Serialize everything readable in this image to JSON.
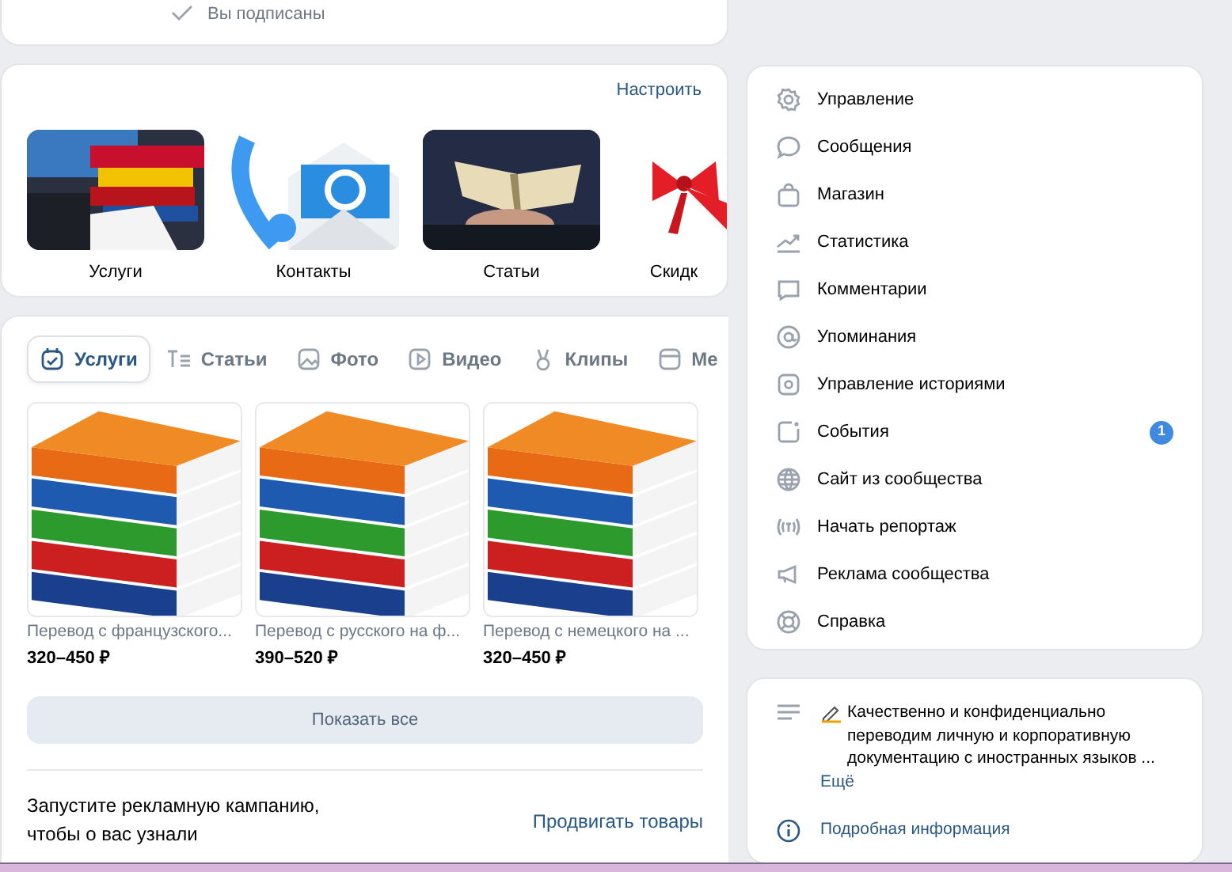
{
  "subscription": {
    "label": "Вы подписаны"
  },
  "covers": {
    "action": "Настроить",
    "items": [
      {
        "label": "Услуги",
        "kind": "picture"
      },
      {
        "label": "Контакты",
        "kind": "picture"
      },
      {
        "label": "Статьи",
        "kind": "picture"
      },
      {
        "label": "Скидк",
        "kind": "picture"
      }
    ]
  },
  "tabs": [
    {
      "label": "Услуги",
      "selected": true
    },
    {
      "label": "Статьи",
      "selected": false
    },
    {
      "label": "Фото",
      "selected": false
    },
    {
      "label": "Видео",
      "selected": false
    },
    {
      "label": "Клипы",
      "selected": false
    },
    {
      "label": "Ме",
      "selected": false
    }
  ],
  "products": [
    {
      "title": "Перевод с французского...",
      "price": "320–450 ₽"
    },
    {
      "title": "Перевод с русского на ф...",
      "price": "390–520 ₽"
    },
    {
      "title": "Перевод с немецкого на ...",
      "price": "320–450 ₽"
    }
  ],
  "show_all": "Показать все",
  "promo": {
    "text": "Запустите рекламную кампанию, чтобы о вас узнали",
    "action": "Продвигать товары"
  },
  "menu": [
    {
      "label": "Управление"
    },
    {
      "label": "Сообщения"
    },
    {
      "label": "Магазин"
    },
    {
      "label": "Статистика"
    },
    {
      "label": "Комментарии"
    },
    {
      "label": "Упоминания"
    },
    {
      "label": "Управление историями"
    },
    {
      "label": "События",
      "badge": "1"
    },
    {
      "label": "Сайт из сообщества"
    },
    {
      "label": "Начать репортаж"
    },
    {
      "label": "Реклама сообщества"
    },
    {
      "label": "Справка"
    }
  ],
  "info": {
    "description": "Качественно и конфиденциально переводим личную и корпоративную документацию с иностранных языков ...",
    "more": "Ещё",
    "details": "Подробная информация"
  }
}
